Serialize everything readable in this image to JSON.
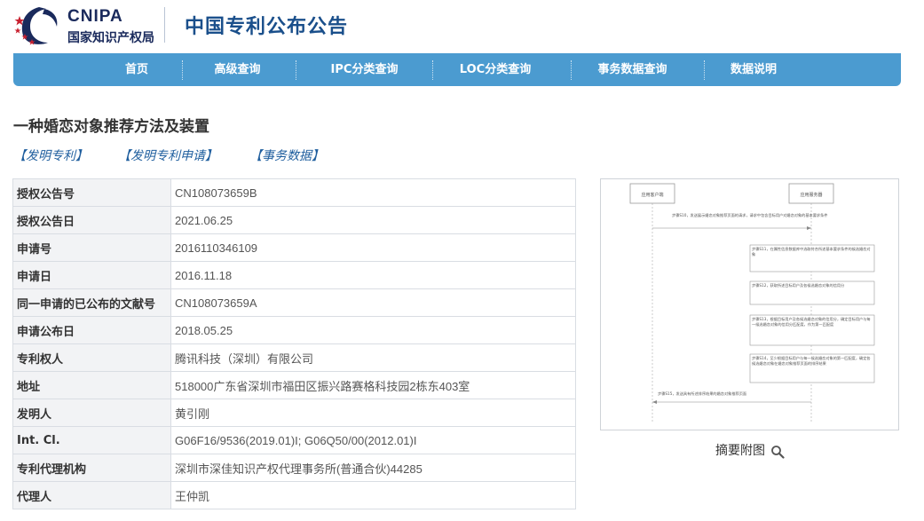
{
  "header": {
    "logo_top": "CNIPA",
    "logo_bottom": "国家知识产权局",
    "site_title": "中国专利公布公告"
  },
  "nav": [
    "首页",
    "高级查询",
    "IPC分类查询",
    "LOC分类查询",
    "事务数据查询",
    "数据说明"
  ],
  "patent": {
    "title": "一种婚恋对象推荐方法及装置",
    "links": [
      "【发明专利】",
      "【发明专利申请】",
      "【事务数据】"
    ]
  },
  "fields": [
    {
      "key": "授权公告号",
      "value": "CN108073659B"
    },
    {
      "key": "授权公告日",
      "value": "2021.06.25"
    },
    {
      "key": "申请号",
      "value": "2016110346109"
    },
    {
      "key": "申请日",
      "value": "2016.11.18"
    },
    {
      "key": "同一申请的已公布的文献号",
      "value": "CN108073659A"
    },
    {
      "key": "申请公布日",
      "value": "2018.05.25"
    },
    {
      "key": "专利权人",
      "value": "腾讯科技（深圳）有限公司"
    },
    {
      "key": "地址",
      "value": "518000广东省深圳市福田区振兴路赛格科技园2栋东403室"
    },
    {
      "key": "发明人",
      "value": "黄引刚"
    },
    {
      "key": "Int. Cl.",
      "value": "G06F16/9536(2019.01)I;  G06Q50/00(2012.01)I"
    },
    {
      "key": "专利代理机构",
      "value": "深圳市深佳知识产权代理事务所(普通合伙)44285"
    },
    {
      "key": "代理人",
      "value": "王仲凯"
    }
  ],
  "drawing": {
    "caption": "摘要附图",
    "actor_left": "应用客户端",
    "actor_right": "应用服务器",
    "steps": [
      "步骤S10，发送展示婚恋对象推荐页面的请求，请求中包含目标用户对婚恋对象的基本要求条件",
      "步骤S11，在属性信息数据库中选取符合所述基本要求条件的候选婚恋对象",
      "步骤S12，获取所述目标用户及各候选婚恋对象的信用分",
      "步骤S13，根据目标用户及各候选婚恋对象的信用分，确定目标用户与每一候选婚恋对象的信用分匹配度，作为第一匹配度",
      "步骤S14，至少根据目标用户与每一候选婚恋对象的第一匹配度，确定各候选婚恋对象在婚恋对象推荐页面的排序结果",
      "步骤S15，发送具有所述排序结果的婚恋对象推荐页面"
    ]
  },
  "colors": {
    "nav_bg": "#4b9bd0",
    "title_blue": "#1a4f8b",
    "link_blue": "#1f5e9e",
    "logo_red": "#c8202f"
  },
  "icons": {
    "logo": "cnipa-logo-icon",
    "search": "magnifier-icon"
  }
}
